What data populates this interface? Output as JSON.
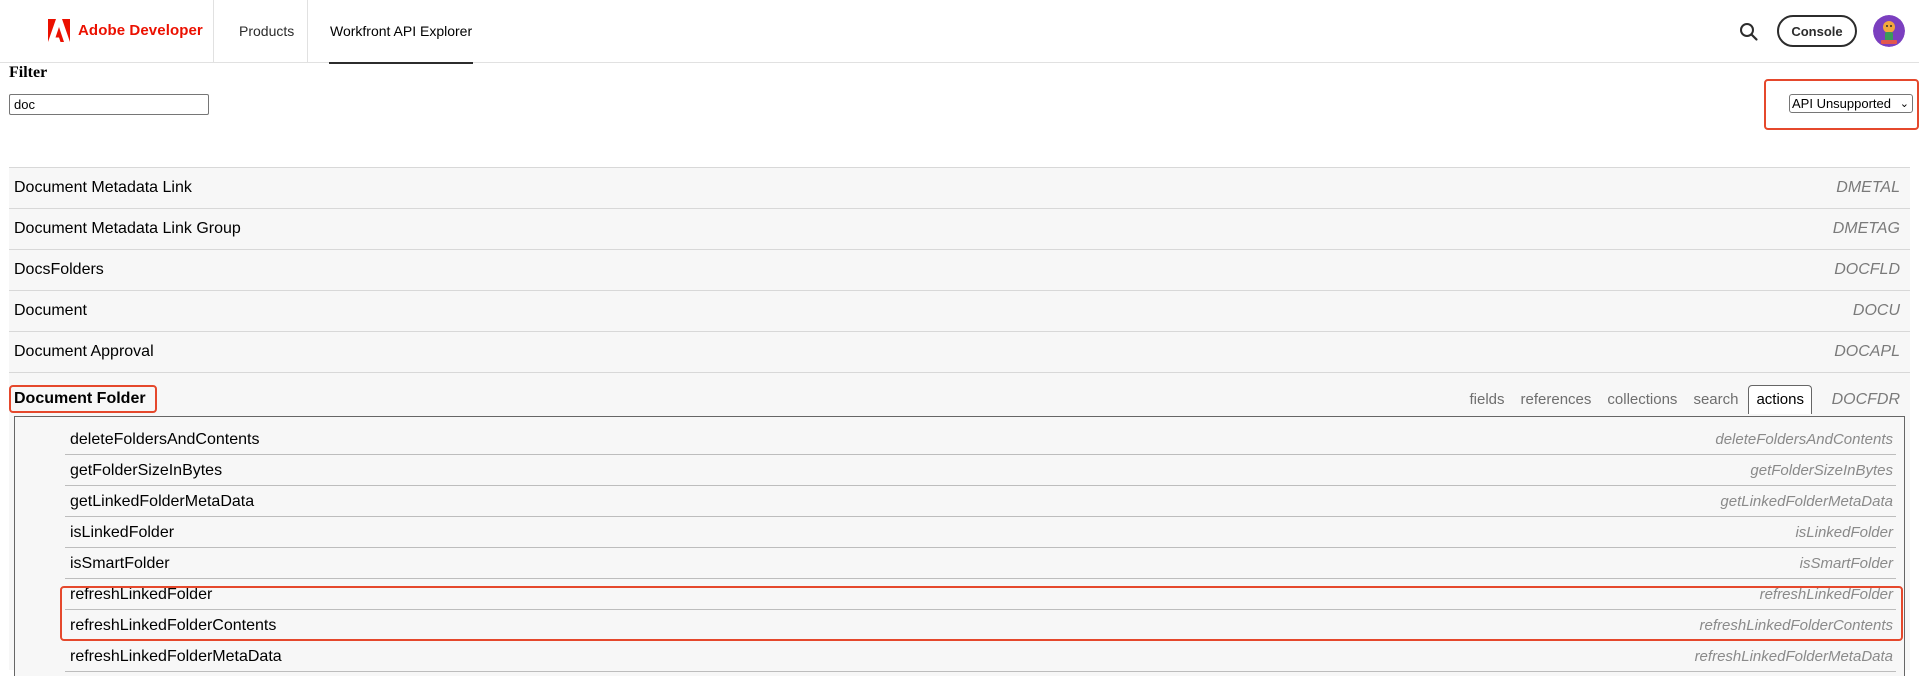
{
  "header": {
    "brand_name": "Adobe Developer",
    "brand_color": "#eb1000",
    "nav": {
      "products": "Products",
      "api_explorer": "Workfront API Explorer"
    },
    "search_icon": "search-icon",
    "console_label": "Console",
    "avatar_icon": "user-avatar"
  },
  "filter": {
    "label": "Filter",
    "value": "doc",
    "support_select_value": "API Unsupported"
  },
  "objects": [
    {
      "name": "Document Metadata Link",
      "code": "DMETAL"
    },
    {
      "name": "Document Metadata Link Group",
      "code": "DMETAG"
    },
    {
      "name": "DocsFolders",
      "code": "DOCFLD"
    },
    {
      "name": "Document",
      "code": "DOCU"
    },
    {
      "name": "Document Approval",
      "code": "DOCAPL"
    }
  ],
  "expanded": {
    "name": "Document Folder",
    "code": "DOCFDR",
    "tabs": [
      "fields",
      "references",
      "collections",
      "search",
      "actions"
    ],
    "active_tab": "actions",
    "actions": [
      {
        "name": "deleteFoldersAndContents",
        "code": "deleteFoldersAndContents"
      },
      {
        "name": "getFolderSizeInBytes",
        "code": "getFolderSizeInBytes"
      },
      {
        "name": "getLinkedFolderMetaData",
        "code": "getLinkedFolderMetaData"
      },
      {
        "name": "isLinkedFolder",
        "code": "isLinkedFolder"
      },
      {
        "name": "isSmartFolder",
        "code": "isSmartFolder"
      },
      {
        "name": "refreshLinkedFolder",
        "code": "refreshLinkedFolder"
      },
      {
        "name": "refreshLinkedFolderContents",
        "code": "refreshLinkedFolderContents"
      },
      {
        "name": "refreshLinkedFolderMetaData",
        "code": "refreshLinkedFolderMetaData"
      }
    ]
  },
  "highlight_color": "#e5482c"
}
